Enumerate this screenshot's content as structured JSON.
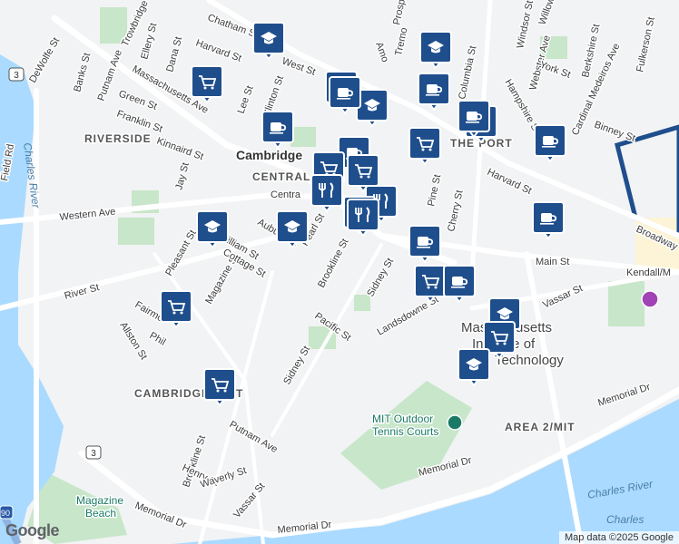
{
  "map": {
    "logo": "Google",
    "attribution": "Map data ©2025 Google",
    "colors": {
      "water": "#aadaff",
      "park": "#c8e6c9",
      "marker": "#1f4e8c",
      "poi": "#1a7a66",
      "road": "#ffffff",
      "highway_yellow": "#fde293"
    }
  },
  "labels": {
    "riverside": "RIVERSIDE",
    "cambridgeport": "CAMBRIDGEPORT",
    "the_port": "THE PORT",
    "area2_mit": "AREA 2/MIT",
    "cambridge": "Cambridge",
    "central": "CENTRAL",
    "charles_river_1": "Charles River",
    "charles_river_2": "Charles River",
    "charles_river_3": "Charles",
    "mit_line1": "Massachusetts",
    "mit_line2": "Institute of",
    "mit_line3": "Technology",
    "mit_tennis_1": "MIT Outdoor",
    "mit_tennis_2": "Tennis Courts",
    "magazine_beach_1": "Magazine",
    "magazine_beach_2": "Beach",
    "kendall": "Kendall/M",
    "route3_a": "3",
    "route3_b": "3",
    "route90": "90"
  },
  "streets": {
    "massachusetts_ave": "Massachusetts Ave",
    "western_ave": "Western Ave",
    "river_st": "River St",
    "main_st": "Main St",
    "memorial_dr_1": "Memorial Dr",
    "memorial_dr_2": "Memorial Dr",
    "memorial_dr_3": "Memorial Dr",
    "memorial_dr_4": "Memorial Dr",
    "broadway": "Broadway",
    "brookline_st_1": "Brookline St",
    "brookline_st_2": "Brookline St",
    "sidney_st_1": "Sidney St",
    "sidney_st_2": "Sidney St",
    "pacific_st": "Pacific St",
    "landsdowne_st": "Landsdowne St",
    "vassar_st_1": "Vassar St",
    "vassar_st_2": "Vassar St",
    "putnam_ave_1": "Putnam Ave",
    "putnam_ave_2": "Putnam Ave",
    "magazine_st": "Magazine St",
    "pleasant_st": "Pleasant St",
    "william_st": "William St",
    "auburn_st": "Auburn St",
    "pearl_st": "Pearl St",
    "cottage_st": "Cottage St",
    "green_st": "Green St",
    "franklin_st": "Franklin St",
    "kinnaird_st": "Kinnaird St",
    "jay_st": "Jay St",
    "banks_st": "Banks St",
    "dewolfe_st": "DeWolfe St",
    "ellery_st": "Ellery St",
    "dana_st": "Dana St",
    "trowbridge_st": "Trowbridge St",
    "lee_st": "Lee St",
    "clinton_st": "Clinton St",
    "harvard_st_1": "Harvard St",
    "harvard_st_2": "Harvard St",
    "chatham_st": "Chatham St",
    "west_st": "West St",
    "columbia_st": "Columbia St",
    "hampshire_st": "Hampshire St",
    "webster_ave": "Webster Ave",
    "cardinal_medeiros_ave": "Cardinal Medeiros Ave",
    "berkshire_st": "Berkshire St",
    "york_st": "York St",
    "binney_st": "Binney St",
    "fulkerson_st": "Fulkerson St",
    "windsor_st": "Windsor St",
    "cherry_st": "Cherry St",
    "pine_st": "Pine St",
    "henry_st": "Henry St",
    "waverly_st": "Waverly St",
    "allston_st": "Allston St",
    "fairmont": "Fairmo",
    "phillips": "Phil",
    "tremont": "Tremo",
    "prospect": "Prosp",
    "amory": "Amo",
    "field_rd": "Field Rd",
    "willow": "Willow",
    "central_label": "Centra"
  },
  "markers": [
    {
      "type": "education",
      "label": "education-marker"
    },
    {
      "type": "grocery",
      "label": "grocery-marker"
    },
    {
      "type": "education",
      "label": "education-marker"
    },
    {
      "type": "cafe",
      "label": "cafe-marker"
    },
    {
      "type": "cafe",
      "label": "cafe-marker"
    },
    {
      "type": "education",
      "label": "education-marker"
    },
    {
      "type": "cafe",
      "label": "cafe-marker"
    },
    {
      "type": "cafe",
      "label": "cafe-marker"
    },
    {
      "type": "education",
      "label": "education-marker"
    },
    {
      "type": "grocery",
      "label": "grocery-marker"
    },
    {
      "type": "cafe",
      "label": "cafe-marker"
    },
    {
      "type": "cafe",
      "label": "cafe-marker"
    },
    {
      "type": "cafe",
      "label": "cafe-marker"
    },
    {
      "type": "grocery",
      "label": "grocery-marker"
    },
    {
      "type": "grocery",
      "label": "grocery-marker"
    },
    {
      "type": "restaurant",
      "label": "restaurant-marker"
    },
    {
      "type": "restaurant",
      "label": "restaurant-marker"
    },
    {
      "type": "cafe",
      "label": "cafe-marker"
    },
    {
      "type": "restaurant",
      "label": "restaurant-marker"
    },
    {
      "type": "education",
      "label": "education-marker"
    },
    {
      "type": "education",
      "label": "education-marker"
    },
    {
      "type": "cafe",
      "label": "cafe-marker"
    },
    {
      "type": "cafe",
      "label": "cafe-marker"
    },
    {
      "type": "grocery",
      "label": "grocery-marker"
    },
    {
      "type": "cafe",
      "label": "cafe-marker"
    },
    {
      "type": "education",
      "label": "education-marker"
    },
    {
      "type": "grocery",
      "label": "grocery-marker"
    },
    {
      "type": "education",
      "label": "education-marker"
    },
    {
      "type": "grocery",
      "label": "grocery-marker"
    },
    {
      "type": "grocery",
      "label": "grocery-marker"
    }
  ]
}
